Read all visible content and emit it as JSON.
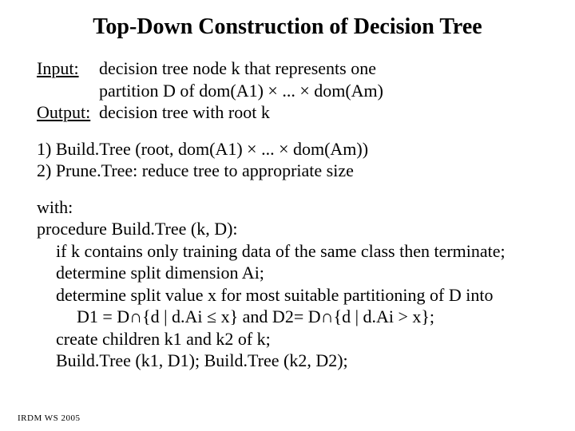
{
  "title": "Top-Down Construction of Decision Tree",
  "io": {
    "input_label": "Input:",
    "input_line1": "decision tree node k that represents one",
    "input_line2": "partition D of dom(A1) × ... × dom(Am)",
    "output_label": "Output:",
    "output_text": "decision tree with root k"
  },
  "steps": {
    "s1": "1)  Build.Tree (root, dom(A1) × ... × dom(Am))",
    "s2": "2)  Prune.Tree: reduce tree to appropriate size"
  },
  "proc": {
    "with": "with:",
    "sig": "procedure Build.Tree (k, D):",
    "l1": "if k contains only training data of the same class then terminate;",
    "l2": "determine split dimension Ai;",
    "l3": "determine split value x for most suitable partitioning of D into",
    "l4": "D1 = D∩{d | d.Ai ≤ x} and D2= D∩{d | d.Ai > x};",
    "l5": "create children k1 and k2 of k;",
    "l6": "Build.Tree (k1, D1); Build.Tree (k2, D2);"
  },
  "footer": "IRDM  WS 2005"
}
